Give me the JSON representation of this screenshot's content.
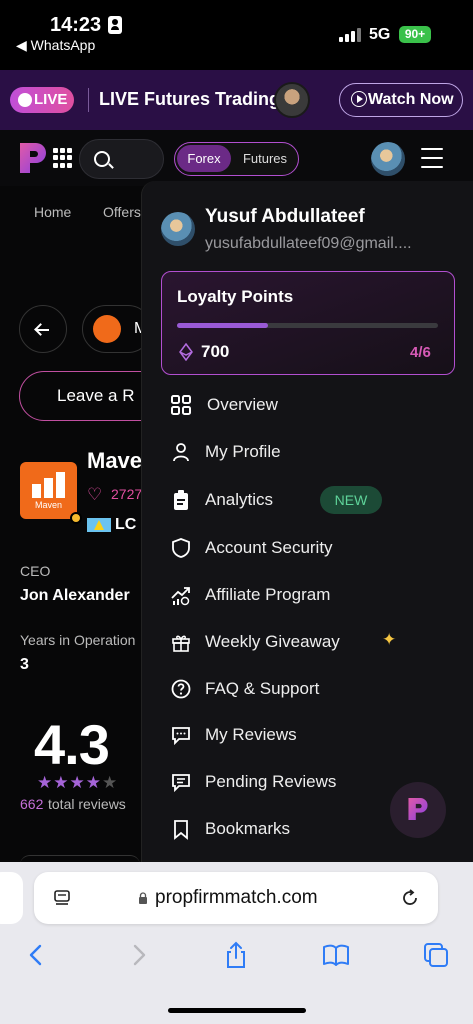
{
  "status_bar": {
    "time": "14:23",
    "back_app": "◀ WhatsApp",
    "network": "5G",
    "battery": "90+"
  },
  "live_banner": {
    "live_label": "LIVE",
    "title": "LIVE Futures Trading",
    "watch_label": "Watch Now"
  },
  "navbar": {
    "toggle": {
      "forex": "Forex",
      "futures": "Futures"
    }
  },
  "page": {
    "subnav": {
      "home": "Home",
      "offers": "Offers"
    },
    "firm_chip_letter": "M",
    "review_button": "Leave a R",
    "firm": {
      "name": "Mave",
      "logo_text": "Maven",
      "likes": "2727",
      "country": "LC"
    },
    "ceo_label": "CEO",
    "ceo_name": "Jon Alexander",
    "years_label": "Years in Operation",
    "years_value": "3",
    "rating": "4.3",
    "rating_stars_filled": 4.3,
    "rating_stars_total": 5,
    "reviews_count": "662",
    "reviews_label": "total reviews"
  },
  "dropdown": {
    "user_name": "Yusuf Abdullateef",
    "email": "yusufabdullateef09@gmail....",
    "loyalty": {
      "title": "Loyalty Points",
      "points": "700",
      "level": "4/6",
      "progress_fraction": 0.35
    },
    "items": [
      {
        "label": "Overview",
        "icon": "grid-icon"
      },
      {
        "label": "My Profile",
        "icon": "user-icon"
      },
      {
        "label": "Analytics",
        "icon": "clipboard-icon",
        "badge": "NEW"
      },
      {
        "label": "Account Security",
        "icon": "shield-icon"
      },
      {
        "label": "Affiliate Program",
        "icon": "growth-chart-icon"
      },
      {
        "label": "Weekly Giveaway",
        "icon": "gift-icon"
      },
      {
        "label": "FAQ & Support",
        "icon": "help-icon"
      },
      {
        "label": "My Reviews",
        "icon": "chat-icon"
      },
      {
        "label": "Pending Reviews",
        "icon": "chat-lines-icon"
      },
      {
        "label": "Bookmarks",
        "icon": "bookmark-icon"
      }
    ]
  },
  "safari": {
    "url": "propfirmmatch.com"
  },
  "colors": {
    "accent_purple": "#b24fd0",
    "accent_pink": "#d65ab6",
    "new_badge_bg": "#1c4a36",
    "new_badge_text": "#5fd49a",
    "brand_orange": "#f06a1a"
  }
}
